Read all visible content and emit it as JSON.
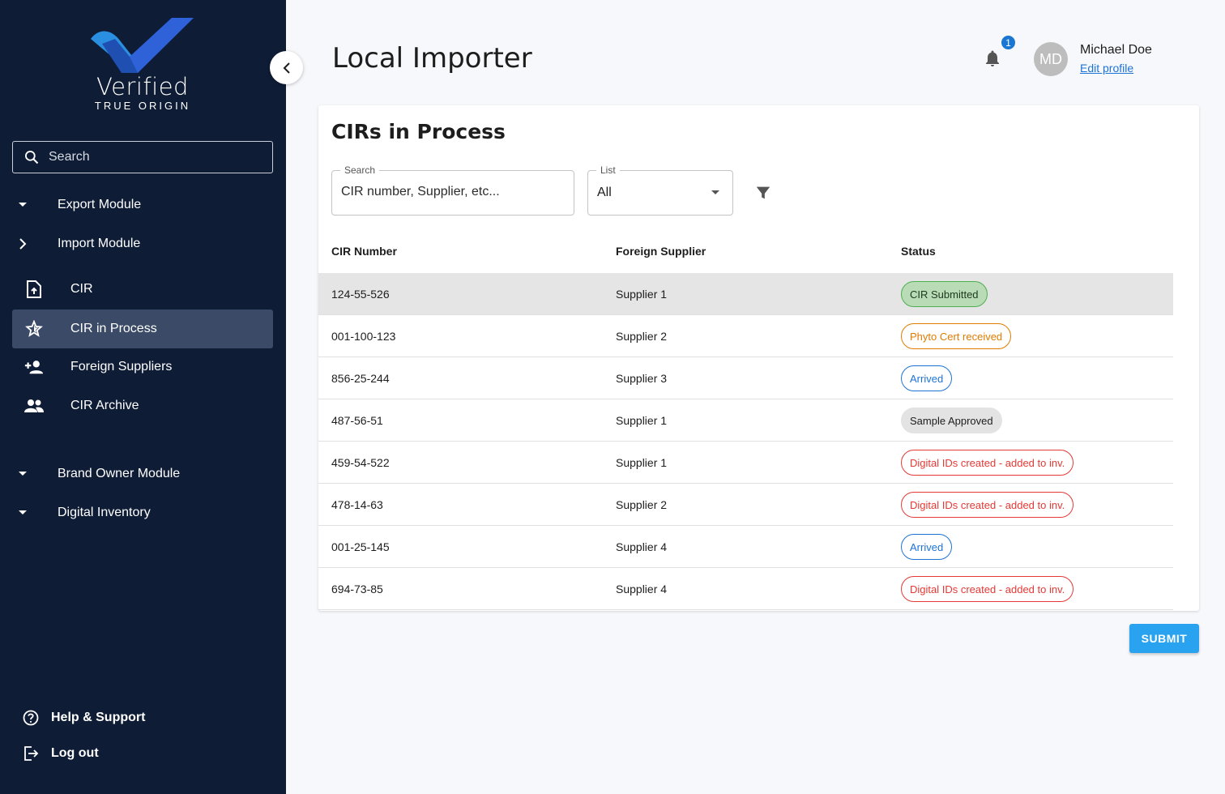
{
  "brand": {
    "name": "Verified",
    "tagline": "TRUE ORIGIN",
    "colors": {
      "primary_dark": "#0e1c36",
      "accent": "#29a3f0",
      "logo_blue": "#1f4fb0"
    }
  },
  "sidebar": {
    "search_placeholder": "Search",
    "modules": [
      {
        "label": "Export Module",
        "icon": "caret-down-icon"
      },
      {
        "label": "Import Module",
        "icon": "chevron-right-icon"
      },
      {
        "label": "Brand Owner Module",
        "icon": "caret-down-icon"
      },
      {
        "label": "Digital Inventory",
        "icon": "caret-down-icon"
      }
    ],
    "import_items": [
      {
        "label": "CIR",
        "icon": "file-upload-icon"
      },
      {
        "label": "CIR in Process",
        "icon": "star-icon",
        "active": true
      },
      {
        "label": "Foreign Suppliers",
        "icon": "add-person-icon"
      },
      {
        "label": "CIR Archive",
        "icon": "people-icon"
      }
    ],
    "footer": {
      "help": "Help & Support",
      "logout": "Log out"
    }
  },
  "header": {
    "title": "Local Importer",
    "notifications_count": "1",
    "user": {
      "initials": "MD",
      "name": "Michael Doe",
      "edit_profile": "Edit profile"
    }
  },
  "main": {
    "card_title": "CIRs in Process",
    "search": {
      "label": "Search",
      "placeholder": "CIR number, Supplier, etc..."
    },
    "list": {
      "label": "List",
      "value": "All"
    },
    "columns": [
      "CIR Number",
      "Foreign Supplier",
      "Status"
    ],
    "rows": [
      {
        "cir": "124-55-526",
        "supplier": "Supplier 1",
        "status": "CIR Submitted",
        "status_color": "green"
      },
      {
        "cir": "001-100-123",
        "supplier": "Supplier 2",
        "status": "Phyto Cert received",
        "status_color": "orange"
      },
      {
        "cir": "856-25-244",
        "supplier": "Supplier 3",
        "status": "Arrived",
        "status_color": "blue"
      },
      {
        "cir": "487-56-51",
        "supplier": "Supplier 1",
        "status": "Sample Approved",
        "status_color": "grey"
      },
      {
        "cir": "459-54-522",
        "supplier": "Supplier 1",
        "status": "Digital IDs created - added to inv.",
        "status_color": "red"
      },
      {
        "cir": "478-14-63",
        "supplier": "Supplier 2",
        "status": "Digital IDs created - added to inv.",
        "status_color": "red"
      },
      {
        "cir": "001-25-145",
        "supplier": "Supplier 4",
        "status": "Arrived",
        "status_color": "blue"
      },
      {
        "cir": "694-73-85",
        "supplier": "Supplier 4",
        "status": "Digital IDs created - added to inv.",
        "status_color": "red"
      }
    ],
    "submit_label": "SUBMIT"
  }
}
